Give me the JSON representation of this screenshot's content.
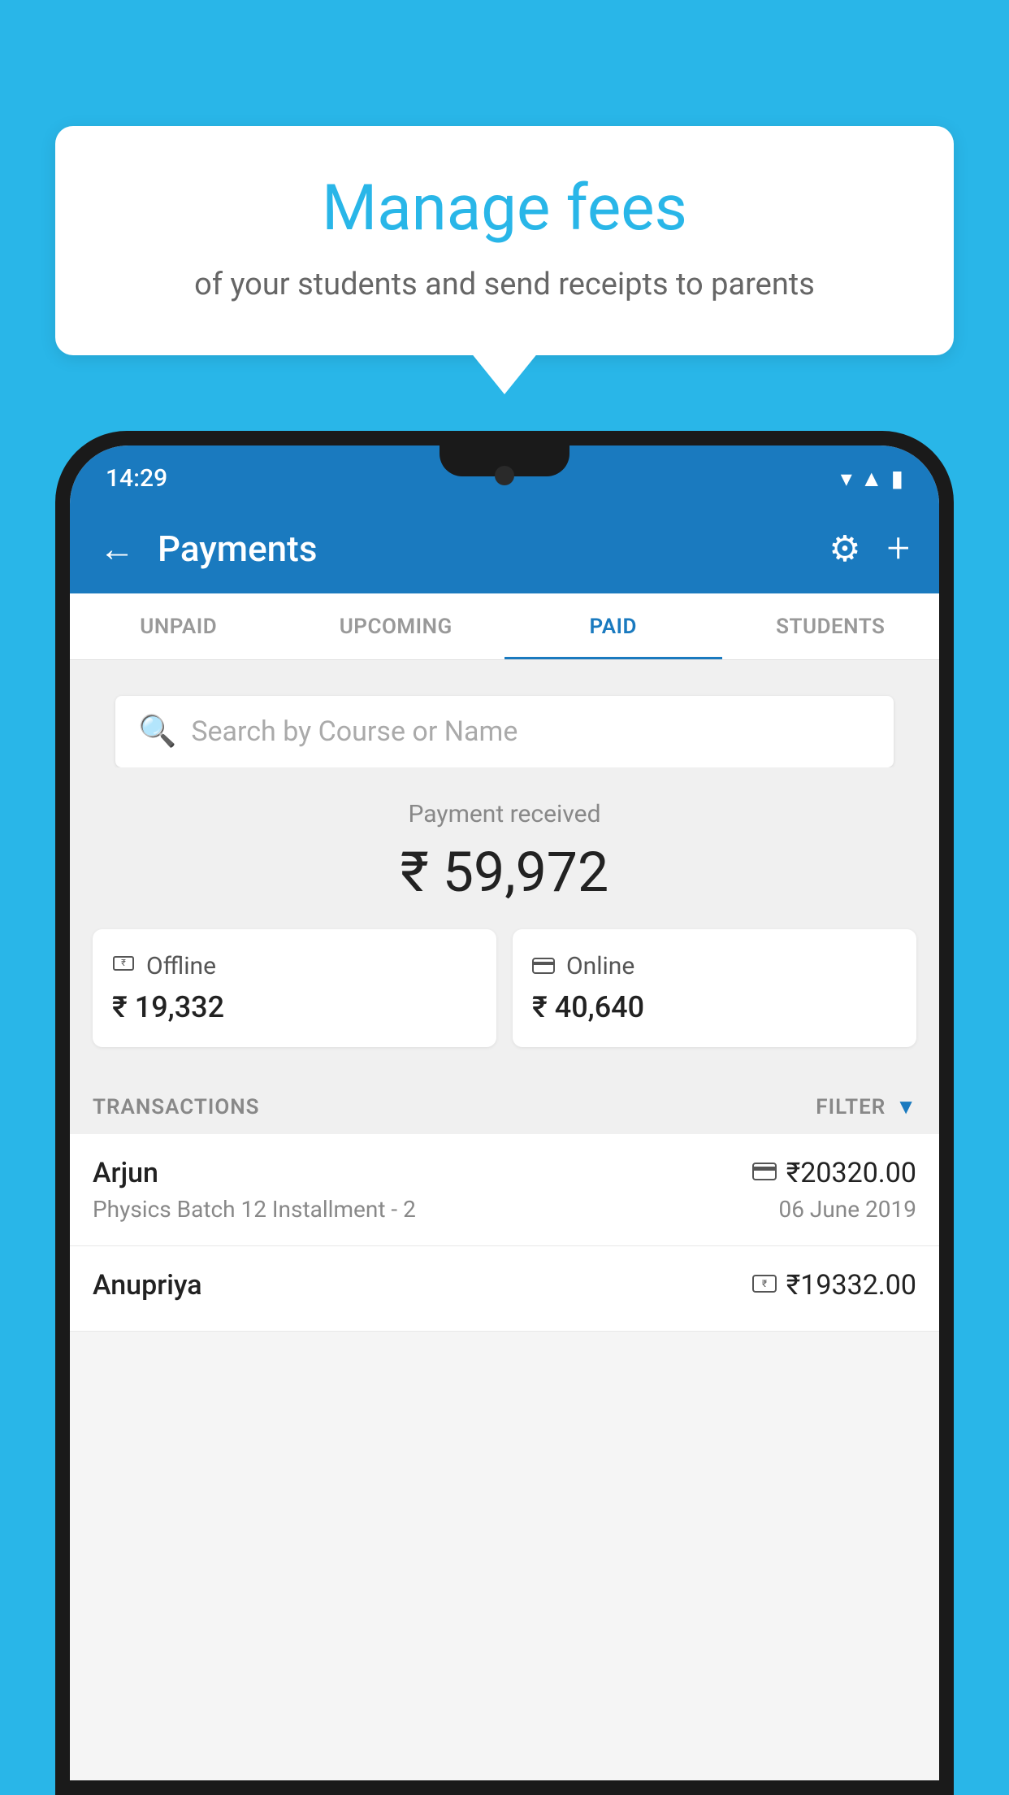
{
  "background": {
    "color": "#29b6e8"
  },
  "tooltip": {
    "title": "Manage fees",
    "subtitle": "of your students and send receipts to parents"
  },
  "status_bar": {
    "time": "14:29",
    "icons": [
      "wifi",
      "signal",
      "battery"
    ]
  },
  "app_bar": {
    "title": "Payments",
    "back_label": "←",
    "gear_label": "⚙",
    "plus_label": "+"
  },
  "tabs": [
    {
      "label": "UNPAID",
      "active": false
    },
    {
      "label": "UPCOMING",
      "active": false
    },
    {
      "label": "PAID",
      "active": true
    },
    {
      "label": "STUDENTS",
      "active": false
    }
  ],
  "search": {
    "placeholder": "Search by Course or Name"
  },
  "payment_summary": {
    "label": "Payment received",
    "amount": "₹ 59,972",
    "offline": {
      "label": "Offline",
      "amount": "₹ 19,332",
      "icon": "₹"
    },
    "online": {
      "label": "Online",
      "amount": "₹ 40,640",
      "icon": "💳"
    }
  },
  "transactions": {
    "section_label": "TRANSACTIONS",
    "filter_label": "FILTER",
    "items": [
      {
        "name": "Arjun",
        "detail": "Physics Batch 12 Installment - 2",
        "amount": "₹20320.00",
        "date": "06 June 2019",
        "type": "online"
      },
      {
        "name": "Anupriya",
        "detail": "",
        "amount": "₹19332.00",
        "date": "",
        "type": "offline"
      }
    ]
  }
}
